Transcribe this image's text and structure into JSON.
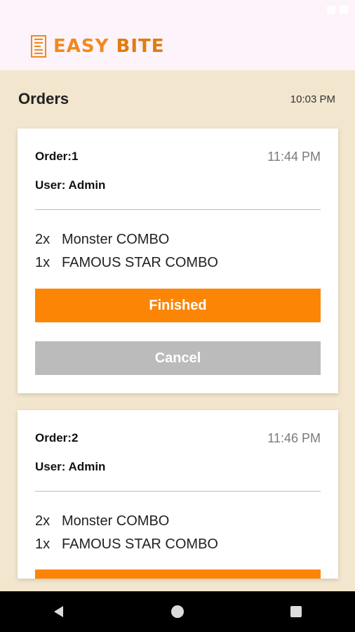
{
  "app": {
    "brand_part1": "EASY",
    "brand_part2": "BITE"
  },
  "orders_header": {
    "title": "Orders",
    "time": "10:03 PM"
  },
  "orders": [
    {
      "label": "Order:1",
      "time": "11:44 PM",
      "user": "User: Admin",
      "items": [
        {
          "qty": "2x",
          "name": "Monster COMBO"
        },
        {
          "qty": "1x",
          "name": "FAMOUS STAR COMBO"
        }
      ],
      "finish_label": "Finished",
      "cancel_label": "Cancel"
    },
    {
      "label": "Order:2",
      "time": "11:46 PM",
      "user": "User: Admin",
      "items": [
        {
          "qty": "2x",
          "name": "Monster COMBO"
        },
        {
          "qty": "1x",
          "name": "FAMOUS STAR COMBO"
        }
      ]
    }
  ],
  "colors": {
    "accent": "#fc8506",
    "background": "#f3e6ce",
    "header": "#fcf3fb",
    "cancel": "#bbbbbb"
  }
}
